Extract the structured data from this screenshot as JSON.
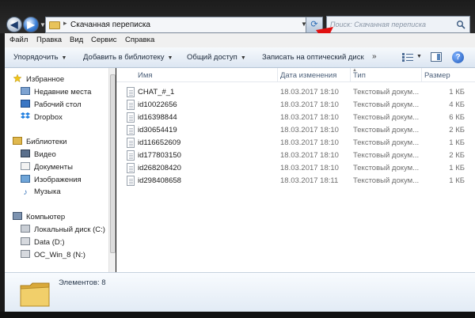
{
  "window": {
    "address_path": "Скачанная переписка",
    "search_placeholder": "Поиск: Скачанная переписка"
  },
  "menu": [
    "Файл",
    "Правка",
    "Вид",
    "Сервис",
    "Справка"
  ],
  "toolbar": {
    "organize": "Упорядочить",
    "add_to_library": "Добавить в библиотеку",
    "share": "Общий доступ",
    "burn": "Записать на оптический диск",
    "more": "»"
  },
  "sidebar": {
    "favorites": {
      "label": "Избранное",
      "items": [
        "Недавние места",
        "Рабочий стол",
        "Dropbox"
      ]
    },
    "libraries": {
      "label": "Библиотеки",
      "items": [
        "Видео",
        "Документы",
        "Изображения",
        "Музыка"
      ]
    },
    "computer": {
      "label": "Компьютер",
      "items": [
        "Локальный диск (C:)",
        "Data (D:)",
        "OC_Win_8 (N:)"
      ]
    }
  },
  "columns": {
    "name": "Имя",
    "date": "Дата изменения",
    "type": "Тип",
    "size": "Размер"
  },
  "files": [
    {
      "name": "CHAT_#_1",
      "date": "18.03.2017 18:10",
      "type": "Текстовый докум...",
      "size": "1 КБ"
    },
    {
      "name": "id10022656",
      "date": "18.03.2017 18:10",
      "type": "Текстовый докум...",
      "size": "4 КБ"
    },
    {
      "name": "id16398844",
      "date": "18.03.2017 18:10",
      "type": "Текстовый докум...",
      "size": "6 КБ"
    },
    {
      "name": "id30654419",
      "date": "18.03.2017 18:10",
      "type": "Текстовый докум...",
      "size": "2 КБ"
    },
    {
      "name": "id116652609",
      "date": "18.03.2017 18:10",
      "type": "Текстовый докум...",
      "size": "1 КБ"
    },
    {
      "name": "id177803150",
      "date": "18.03.2017 18:10",
      "type": "Текстовый докум...",
      "size": "2 КБ"
    },
    {
      "name": "id268208420",
      "date": "18.03.2017 18:10",
      "type": "Текстовый докум...",
      "size": "1 КБ"
    },
    {
      "name": "id298408658",
      "date": "18.03.2017 18:11",
      "type": "Текстовый докум...",
      "size": "1 КБ"
    }
  ],
  "status": {
    "item_count": "Элементов: 8"
  },
  "colors": {
    "annotation_arrow": "#e01010",
    "folder": "#e8c35a"
  }
}
